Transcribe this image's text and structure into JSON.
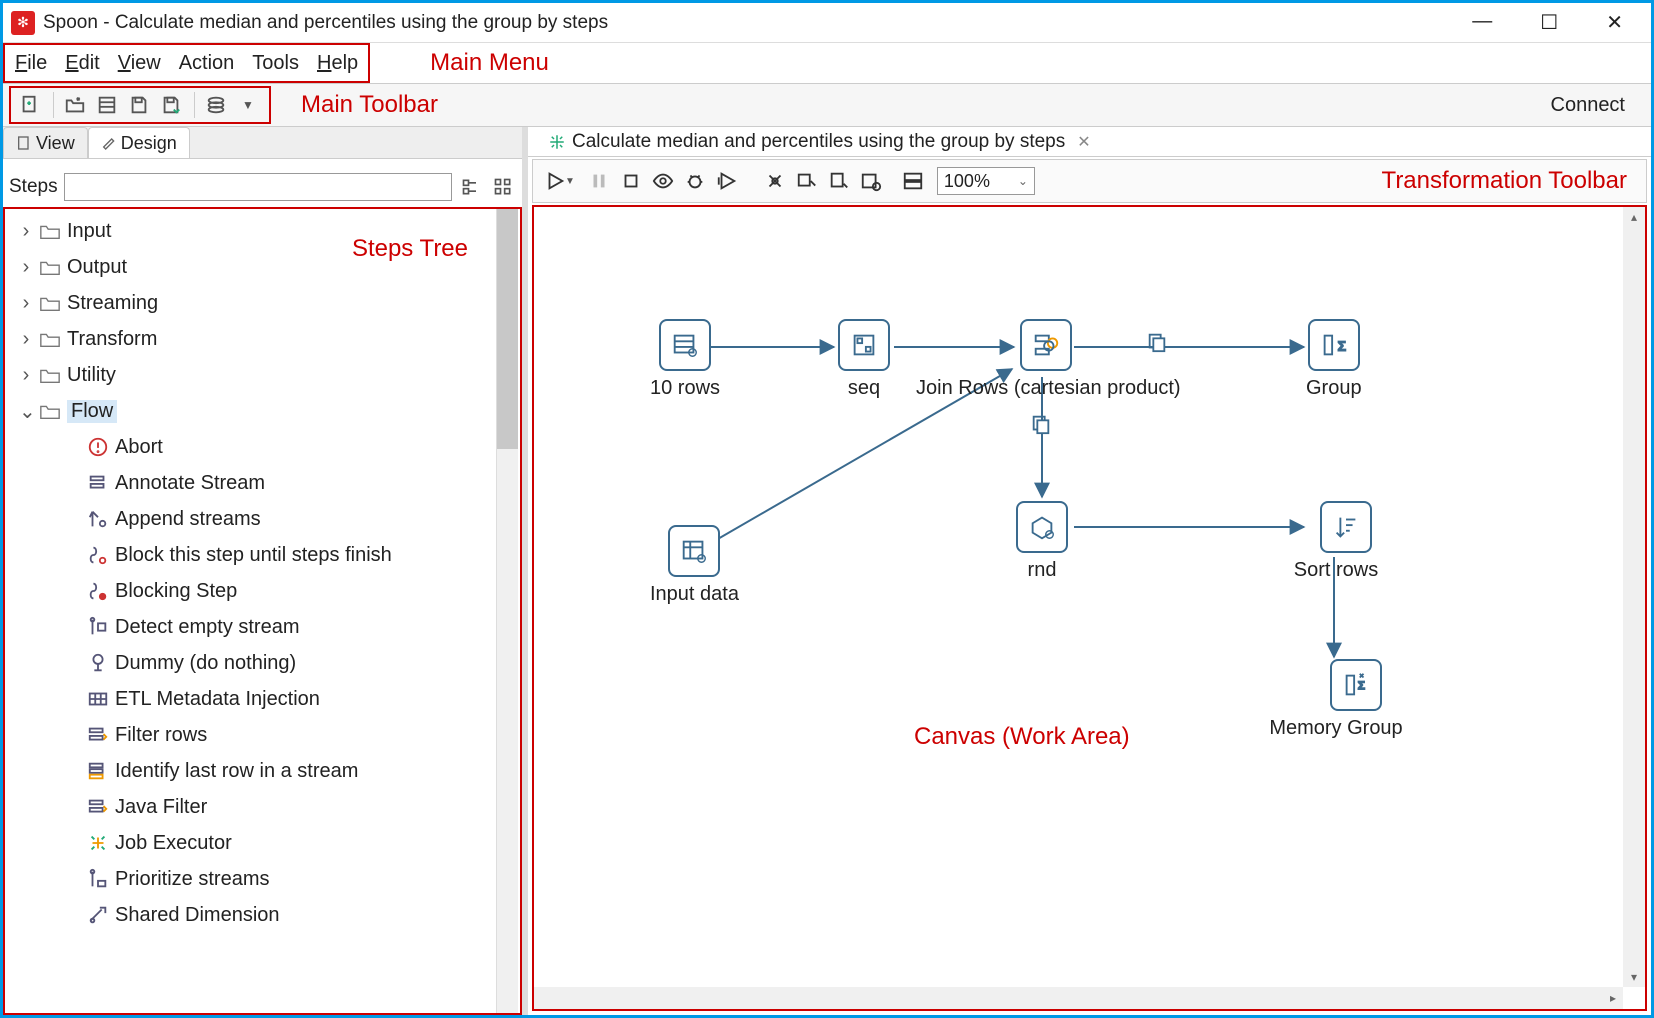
{
  "window": {
    "title": "Spoon - Calculate median and percentiles using the group by steps",
    "connect": "Connect"
  },
  "menu": {
    "file": "File",
    "edit": "Edit",
    "view": "View",
    "action": "Action",
    "tools": "Tools",
    "help": "Help"
  },
  "labels": {
    "main_menu": "Main Menu",
    "main_toolbar": "Main Toolbar",
    "steps_tree": "Steps Tree",
    "transformation_toolbar": "Transformation Toolbar",
    "canvas": "Canvas (Work Area)"
  },
  "left_tabs": {
    "view": "View",
    "design": "Design"
  },
  "steps_bar": {
    "label": "Steps",
    "value": ""
  },
  "tree": {
    "folders": [
      "Input",
      "Output",
      "Streaming",
      "Transform",
      "Utility",
      "Flow"
    ],
    "expanded": "Flow",
    "flow_items": [
      "Abort",
      "Annotate Stream",
      "Append streams",
      "Block this step until steps finish",
      "Blocking Step",
      "Detect empty stream",
      "Dummy (do nothing)",
      "ETL Metadata Injection",
      "Filter rows",
      "Identify last row in a stream",
      "Java Filter",
      "Job Executor",
      "Prioritize streams",
      "Shared Dimension"
    ]
  },
  "canvas": {
    "tab_title": "Calculate median and percentiles using the group by steps",
    "zoom": "100%",
    "nodes": {
      "ten_rows": "10 rows",
      "seq": "seq",
      "join_rows": "Join Rows (cartesian product)",
      "group": "Group",
      "input_data": "Input data",
      "rnd": "rnd",
      "sort_rows": "Sort rows",
      "memory_group": "Memory Group"
    }
  },
  "colors": {
    "accent_red": "#cc0000",
    "node_border": "#3a6a8e",
    "edge": "#3a6a8e"
  }
}
